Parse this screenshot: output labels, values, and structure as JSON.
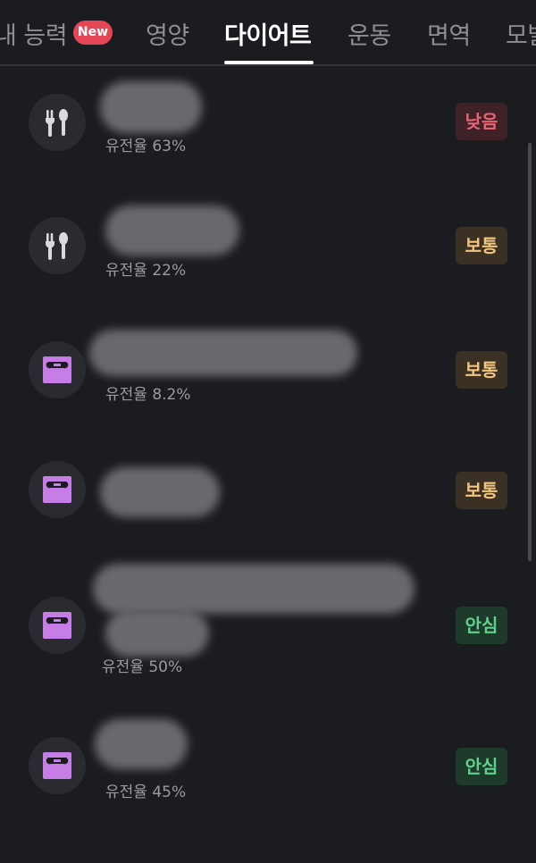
{
  "tabs": [
    {
      "label": "내 능력"
    },
    {
      "label": "영양"
    },
    {
      "label": "다이어트"
    },
    {
      "label": "운동"
    },
    {
      "label": "면역"
    },
    {
      "label": "모발"
    }
  ],
  "new_badge": "New",
  "active_tab": "다이어트",
  "items": [
    {
      "icon": "utensils-icon",
      "heritability": "유전율 63%",
      "level": "낮음",
      "level_color": "#ea6474"
    },
    {
      "icon": "utensils-icon",
      "heritability": "유전율 22%",
      "level": "보통",
      "level_color": "#f2c47f"
    },
    {
      "icon": "scale-icon",
      "heritability": "유전율 8.2%",
      "level": "보통",
      "level_color": "#f2c47f"
    },
    {
      "icon": "scale-icon",
      "heritability": "",
      "level": "보통",
      "level_color": "#f2c47f"
    },
    {
      "icon": "scale-icon",
      "heritability": "유전율 50%",
      "level": "안심",
      "level_color": "#5fd28c"
    },
    {
      "icon": "scale-icon",
      "heritability": "유전율 45%",
      "level": "안심",
      "level_color": "#5fd28c"
    }
  ],
  "colors": {
    "background": "#1b1c20",
    "scale_icon": "#c77de6",
    "utensils_icon": "#d9d9de",
    "new_badge": "#e44656"
  }
}
